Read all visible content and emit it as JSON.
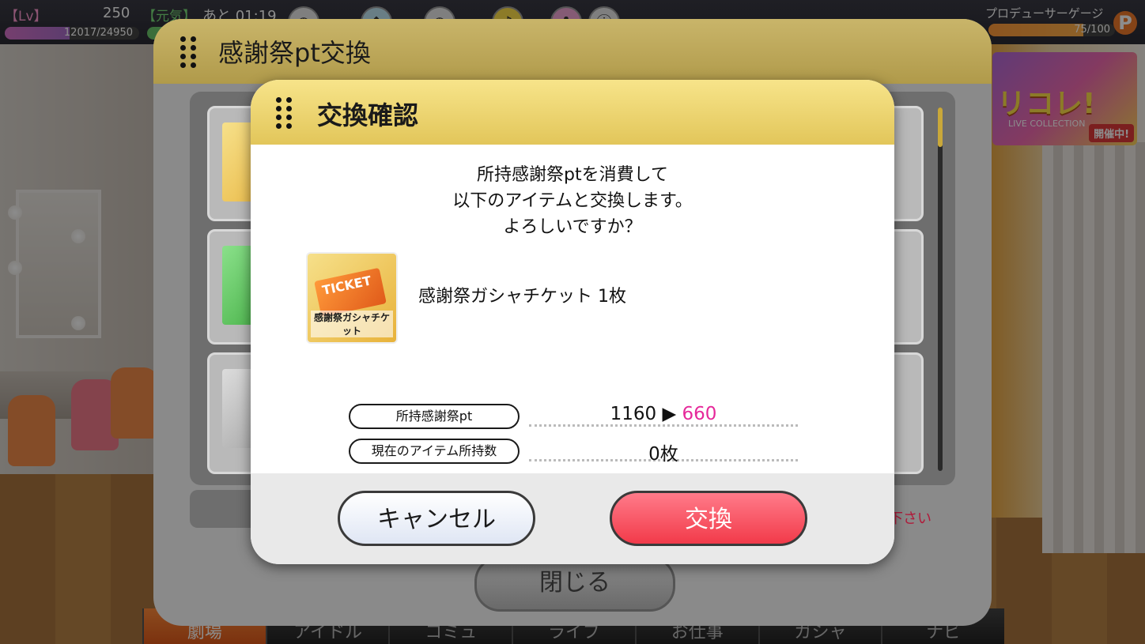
{
  "hud": {
    "level_label": "【Lv】",
    "level_value": "250",
    "genki_label": "【元気】",
    "time_label": "あと 01:19",
    "exp_text": "12017/24950",
    "exp_fraction": 0.48,
    "producer_gauge_label": "プロデューサーゲージ",
    "producer_gauge_text": "75/100",
    "producer_gauge_fraction": 0.75,
    "p_badge": "P"
  },
  "banner": {
    "title": "リコレ!",
    "subtitle": "LIVE COLLECTION",
    "tag": "開催中!"
  },
  "bottom_nav": {
    "items": [
      "劇場",
      "アイドル",
      "コミュ",
      "ライブ",
      "お仕事",
      "ガシャ",
      "ナビ"
    ]
  },
  "panel": {
    "title": "感謝祭pt交換",
    "close_label": "閉じる",
    "notice": "下さい"
  },
  "modal": {
    "title": "交換確認",
    "message_lines": [
      "所持感謝祭ptを消費して",
      "以下のアイテムと交換します。",
      "よろしいですか？"
    ],
    "item_name": "感謝祭ガシャチケット 1枚",
    "item_icon_ticket": "TICKET",
    "item_icon_caption": "感謝祭ガシャチケット",
    "rows": [
      {
        "label": "所持感謝祭pt",
        "value_before": "1160 ▶ ",
        "value_after": "660"
      },
      {
        "label": "現在のアイテム所持数",
        "value_before": "0枚",
        "value_after": ""
      }
    ],
    "cancel_label": "キャンセル",
    "exchange_label": "交換"
  },
  "colors": {
    "accent_pink": "#e6289a",
    "exchange_button": "#f23a4a",
    "header_gold": "#e2c65a"
  }
}
